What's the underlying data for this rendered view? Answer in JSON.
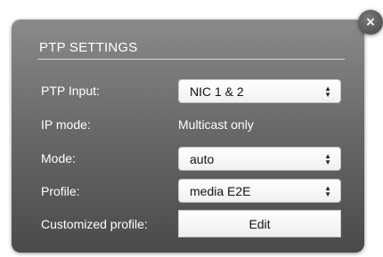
{
  "dialog": {
    "title": "PTP SETTINGS",
    "close_icon": "close-icon",
    "close_glyph": "×"
  },
  "fields": {
    "ptp_input": {
      "label": "PTP Input:",
      "value": "NIC 1 & 2"
    },
    "ip_mode": {
      "label": "IP mode:",
      "value": "Multicast only"
    },
    "mode": {
      "label": "Mode:",
      "value": "auto"
    },
    "profile": {
      "label": "Profile:",
      "value": "media E2E"
    },
    "customized_profile": {
      "label": "Customized profile:",
      "button_label": "Edit"
    }
  },
  "icons": {
    "select_arrows": "up-down-chevron-icon"
  }
}
